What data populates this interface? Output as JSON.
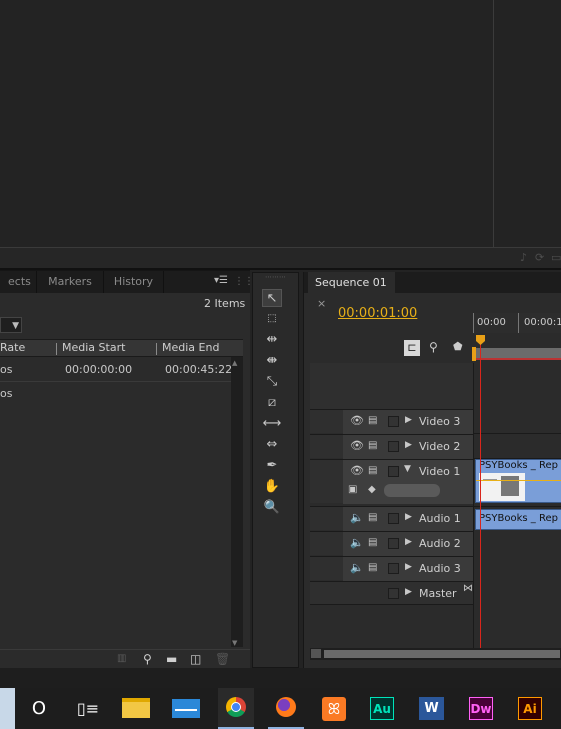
{
  "panel_tabs": {
    "effects": "ects",
    "markers": "Markers",
    "history": "History"
  },
  "project": {
    "item_count": "2 Items",
    "columns": {
      "rate": "Rate",
      "media_start": "Media Start",
      "media_end": "Media End"
    },
    "rows": [
      {
        "rate": "os",
        "media_start": "00:00:00:00",
        "media_end": "00:00:45:22"
      },
      {
        "rate": "os",
        "media_start": "",
        "media_end": ""
      }
    ]
  },
  "sequence": {
    "tab_label": "Sequence 01",
    "close_glyph": "×",
    "timecode": "00:00:01:00",
    "ruler": [
      "00:00",
      "00:00:1"
    ]
  },
  "tracks": {
    "video": [
      {
        "label": "Video 3",
        "expanded": false
      },
      {
        "label": "Video 2",
        "expanded": false
      },
      {
        "label": "Video 1",
        "expanded": true
      }
    ],
    "audio": [
      {
        "label": "Audio 1"
      },
      {
        "label": "Audio 2"
      },
      {
        "label": "Audio 3"
      }
    ],
    "master": "Master"
  },
  "clips": {
    "video_clip": "PSYBooks _ Rep",
    "audio_clip": "PSYBooks _ Rep"
  },
  "taskbar_apps": [
    {
      "icon": "cortana-icon",
      "label": "O"
    },
    {
      "icon": "task-view-icon",
      "label": ""
    },
    {
      "icon": "file-explorer-icon",
      "label": ""
    },
    {
      "icon": "mail-icon",
      "label": ""
    },
    {
      "icon": "chrome-icon",
      "label": ""
    },
    {
      "icon": "firefox-icon",
      "label": ""
    },
    {
      "icon": "xampp-icon",
      "label": "ꕤ"
    },
    {
      "icon": "audition-icon",
      "label": "Au"
    },
    {
      "icon": "word-icon",
      "label": "W"
    },
    {
      "icon": "dreamweaver-icon",
      "label": "Dw"
    },
    {
      "icon": "illustrator-icon",
      "label": "Ai"
    }
  ],
  "colors": {
    "timecode": "#e8b017",
    "playhead": "#d9261c",
    "clip_blue": "#7a9ed8",
    "audition": "#00e4bb",
    "dreamweaver": "#ff61f6",
    "illustrator": "#ff9a00",
    "word": "#2b579a"
  }
}
